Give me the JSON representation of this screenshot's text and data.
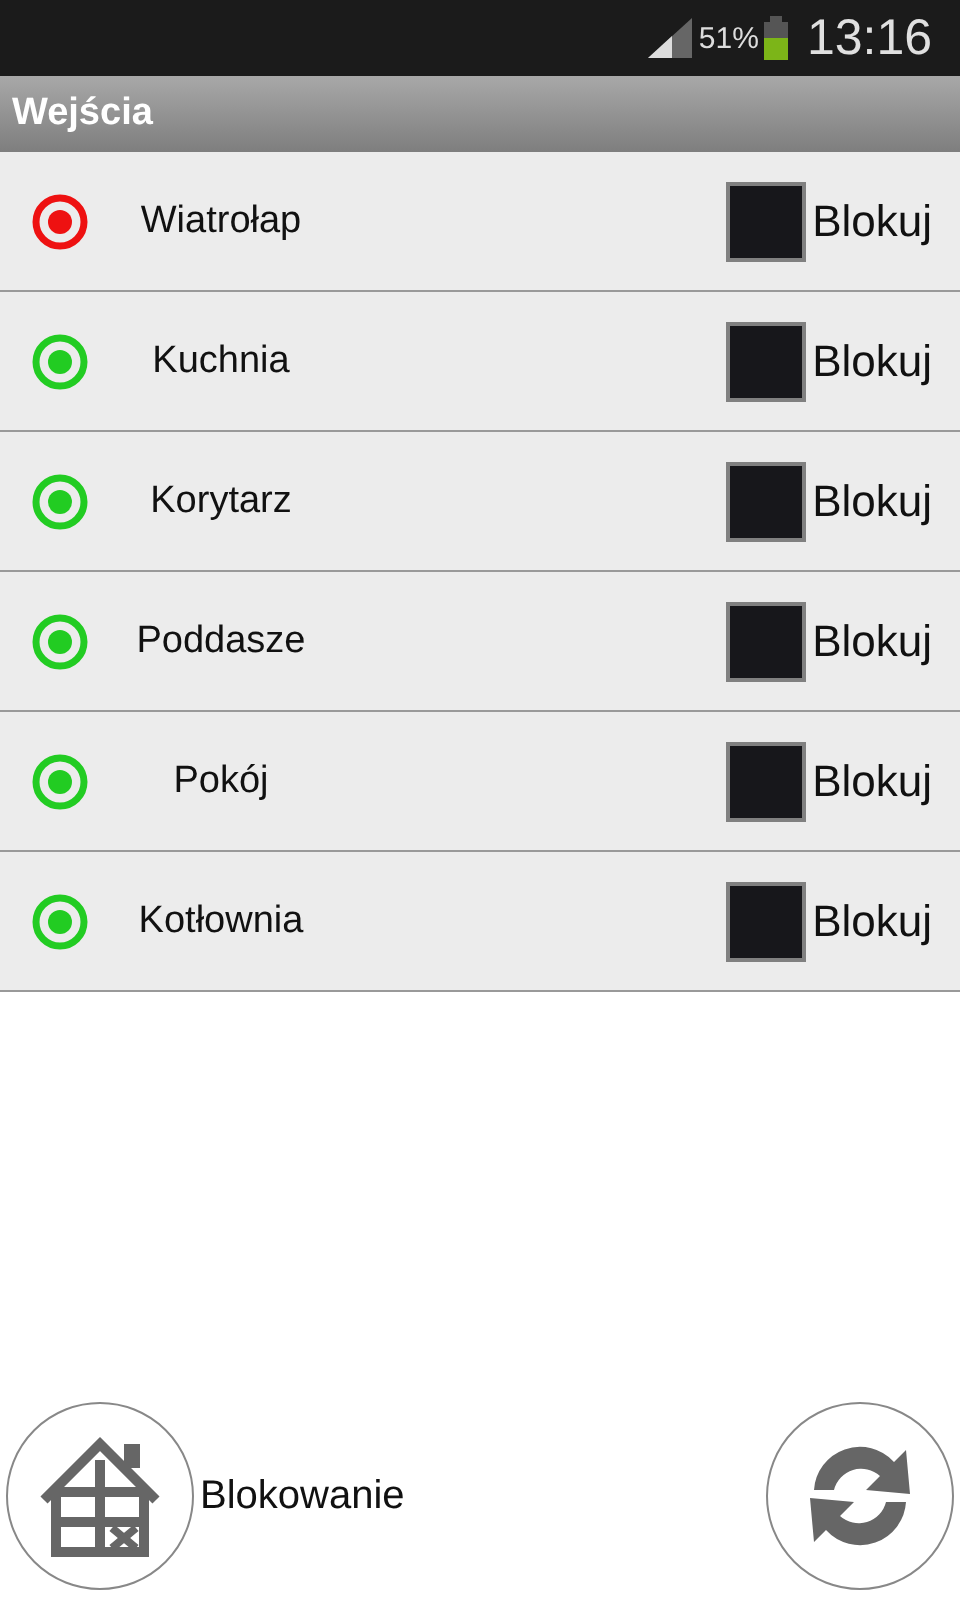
{
  "status_bar": {
    "battery": "51%",
    "time": "13:16"
  },
  "title": "Wejścia",
  "inputs": [
    {
      "name": "Wiatrołap",
      "color": "#ee1111",
      "checked": false,
      "label": "Blokuj"
    },
    {
      "name": "Kuchnia",
      "color": "#22cc22",
      "checked": false,
      "label": "Blokuj"
    },
    {
      "name": "Korytarz",
      "color": "#22cc22",
      "checked": false,
      "label": "Blokuj"
    },
    {
      "name": "Poddasze",
      "color": "#22cc22",
      "checked": false,
      "label": "Blokuj"
    },
    {
      "name": "Pokój",
      "color": "#22cc22",
      "checked": false,
      "label": "Blokuj"
    },
    {
      "name": "Kotłownia",
      "color": "#22cc22",
      "checked": false,
      "label": "Blokuj"
    }
  ],
  "footer": {
    "lock_label": "Blokowanie"
  }
}
